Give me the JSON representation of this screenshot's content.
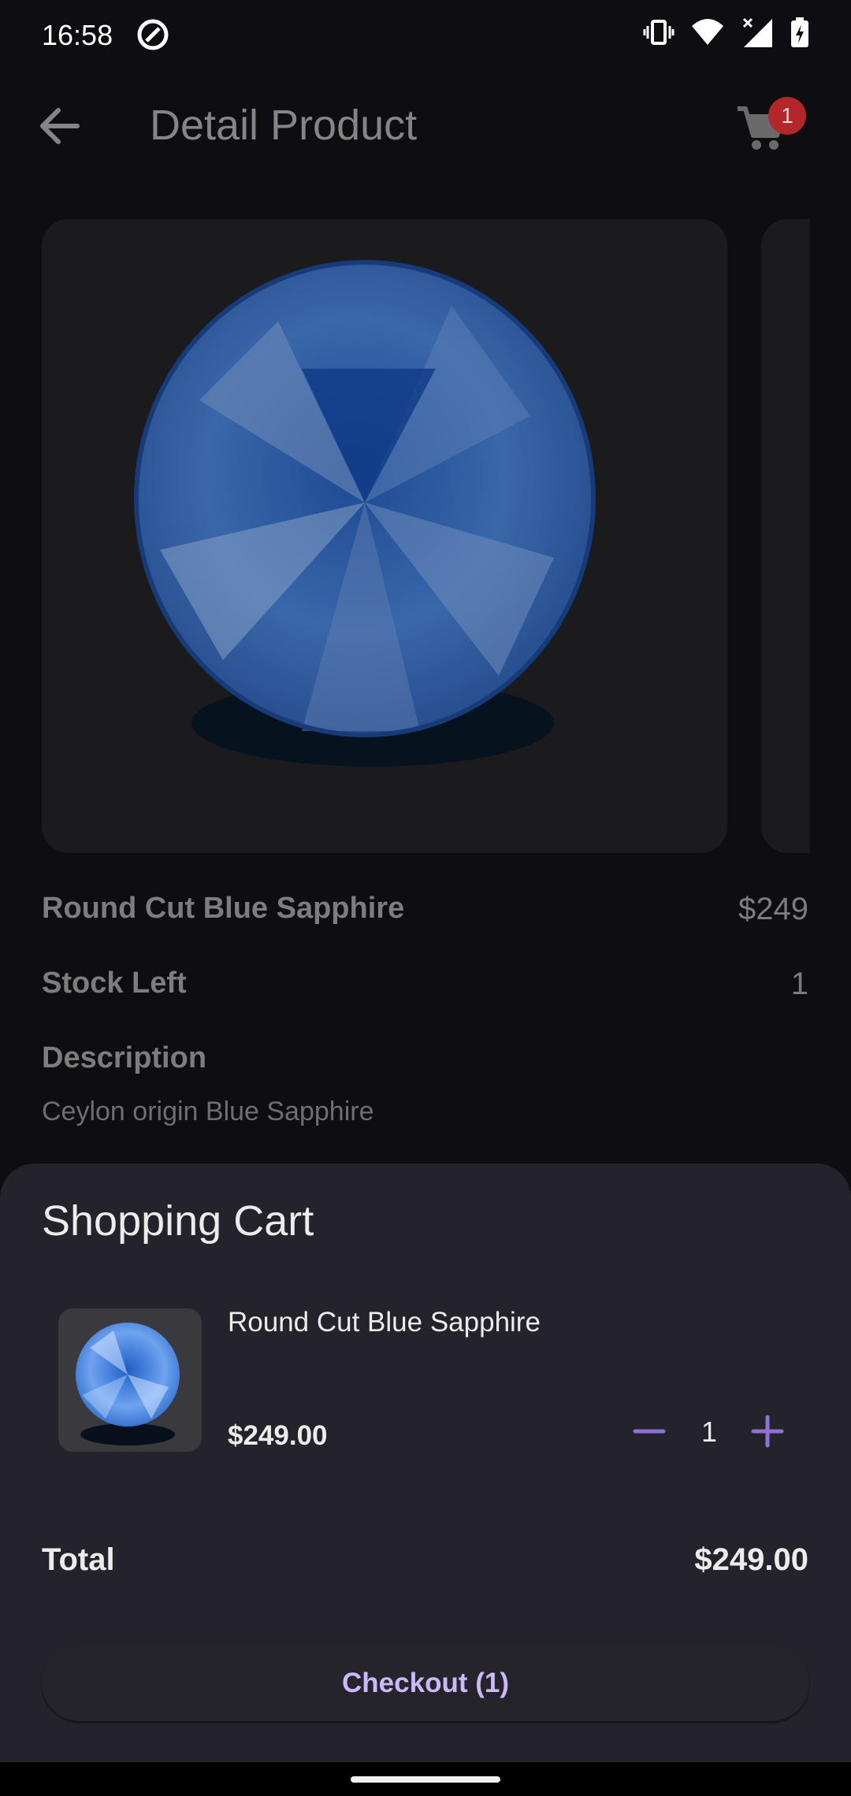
{
  "status_bar": {
    "time": "16:58"
  },
  "app_bar": {
    "title": "Detail Product",
    "cart_badge_count": "1"
  },
  "product": {
    "name": "Round Cut Blue Sapphire",
    "price": "$249",
    "stock_label": "Stock Left",
    "stock_value": "1",
    "description_label": "Description",
    "description": "Ceylon origin Blue Sapphire"
  },
  "cart_sheet": {
    "title": "Shopping Cart",
    "item": {
      "name": "Round Cut Blue Sapphire",
      "price": "$249.00",
      "quantity": "1"
    },
    "total_label": "Total",
    "total_value": "$249.00",
    "checkout_label": "Checkout (1)"
  },
  "colors": {
    "accent": "#8e70d6",
    "badge": "#b3262a",
    "sheet_background": "#24222a"
  }
}
